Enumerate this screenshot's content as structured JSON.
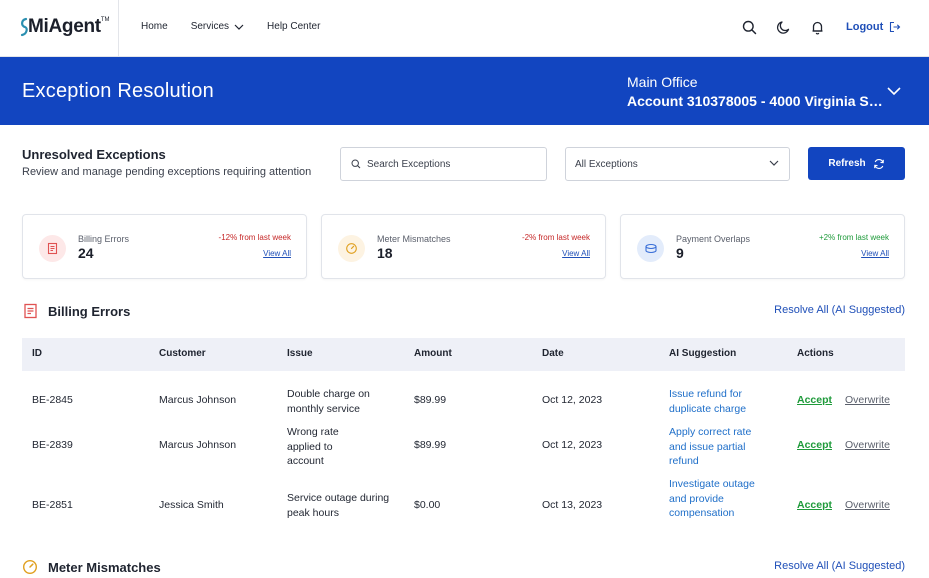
{
  "nav": {
    "logo": "MiAgent",
    "logo_tm": "TM",
    "links": [
      "Home",
      "Services",
      "Help Center"
    ],
    "logout": "Logout"
  },
  "banner": {
    "title": "Exception Resolution",
    "office_name": "Main Office",
    "account": "Account 310378005 - 4000 Virginia St..."
  },
  "section": {
    "title": "Unresolved Exceptions",
    "subtitle": "Review and manage pending exceptions requiring attention",
    "search_placeholder": "Search Exceptions",
    "filter_value": "All Exceptions",
    "refresh_label": "Refresh"
  },
  "cards": [
    {
      "label": "Billing Errors",
      "value": "24",
      "change": "-12% from last week",
      "change_color": "#c62828",
      "view": "View All",
      "icon": "document-icon",
      "icon_bg": "#fde8e8",
      "icon_color": "#e05252"
    },
    {
      "label": "Meter Mismatches",
      "value": "18",
      "change": "-2% from last week",
      "change_color": "#c62828",
      "view": "View All",
      "icon": "gauge-icon",
      "icon_bg": "#fdf3e2",
      "icon_color": "#e0a020"
    },
    {
      "label": "Payment Overlaps",
      "value": "9",
      "change": "+2% from last week",
      "change_color": "#1e9a3a",
      "view": "View All",
      "icon": "coins-icon",
      "icon_bg": "#e3ecfb",
      "icon_color": "#3a6fd8"
    }
  ],
  "billing": {
    "title": "Billing Errors",
    "resolve_all": "Resolve All (AI Suggested)",
    "columns": [
      "ID",
      "Customer",
      "Issue",
      "Amount",
      "Date",
      "AI Suggestion",
      "Actions"
    ],
    "rows": [
      {
        "id": "BE-2845",
        "customer": "Marcus Johnson",
        "issue": "Double charge on monthly service",
        "amount": "$89.99",
        "date": "Oct 12, 2023",
        "ai": "Issue refund for duplicate charge",
        "accept": "Accept",
        "overwrite": "Overwrite"
      },
      {
        "id": "BE-2839",
        "customer": "Marcus Johnson",
        "issue": "Wrong rate applied to account",
        "amount": "$89.99",
        "date": "Oct 12, 2023",
        "ai": "Apply correct rate and issue partial refund",
        "accept": "Accept",
        "overwrite": "Overwrite"
      },
      {
        "id": "BE-2851",
        "customer": "Jessica Smith",
        "issue": "Service outage during peak hours",
        "amount": "$0.00",
        "date": "Oct 13, 2023",
        "ai": "Investigate outage and provide compensation",
        "accept": "Accept",
        "overwrite": "Overwrite"
      }
    ]
  },
  "meter": {
    "title": "Meter Mismatches",
    "resolve_all": "Resolve All (AI Suggested)"
  },
  "colors": {
    "primary": "#1245c0",
    "link": "#1f4fb8",
    "ai_text": "#1f6fc9",
    "accept": "#1e9a3a",
    "negative": "#c62828"
  }
}
